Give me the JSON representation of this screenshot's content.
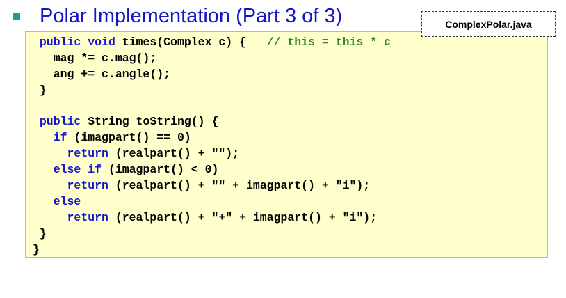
{
  "slide": {
    "title": "Polar Implementation (Part 3 of 3)",
    "file_tag": "ComplexPolar.java"
  },
  "colors": {
    "title": "#1515c8",
    "bullet": "#1a9e94",
    "keyword": "#1515c8",
    "comment": "#2e8b2e",
    "code_background": "#ffffcc",
    "code_border": "#f0a0a0"
  },
  "code": {
    "lines": [
      [
        {
          "t": " "
        },
        {
          "t": "public",
          "k": "kw"
        },
        {
          "t": " "
        },
        {
          "t": "void",
          "k": "kw"
        },
        {
          "t": " times(Complex c) {   "
        },
        {
          "t": "// this = this * c",
          "k": "cm"
        }
      ],
      [
        {
          "t": "   mag *= c.mag();"
        }
      ],
      [
        {
          "t": "   ang += c.angle();"
        }
      ],
      [
        {
          "t": " }"
        }
      ],
      [
        {
          "t": ""
        }
      ],
      [
        {
          "t": " "
        },
        {
          "t": "public",
          "k": "kw"
        },
        {
          "t": " String toString() {"
        }
      ],
      [
        {
          "t": "   "
        },
        {
          "t": "if",
          "k": "kw"
        },
        {
          "t": " (imagpart() == 0)"
        }
      ],
      [
        {
          "t": "     "
        },
        {
          "t": "return",
          "k": "kw"
        },
        {
          "t": " (realpart() + \"\");"
        }
      ],
      [
        {
          "t": "   "
        },
        {
          "t": "else",
          "k": "kw"
        },
        {
          "t": " "
        },
        {
          "t": "if",
          "k": "kw"
        },
        {
          "t": " (imagpart() < 0)"
        }
      ],
      [
        {
          "t": "     "
        },
        {
          "t": "return",
          "k": "kw"
        },
        {
          "t": " (realpart() + \"\" + imagpart() + \"i\");"
        }
      ],
      [
        {
          "t": "   "
        },
        {
          "t": "else",
          "k": "kw"
        }
      ],
      [
        {
          "t": "     "
        },
        {
          "t": "return",
          "k": "kw"
        },
        {
          "t": " (realpart() + \"+\" + imagpart() + \"i\");"
        }
      ],
      [
        {
          "t": " }"
        }
      ],
      [
        {
          "t": "}"
        }
      ]
    ]
  }
}
